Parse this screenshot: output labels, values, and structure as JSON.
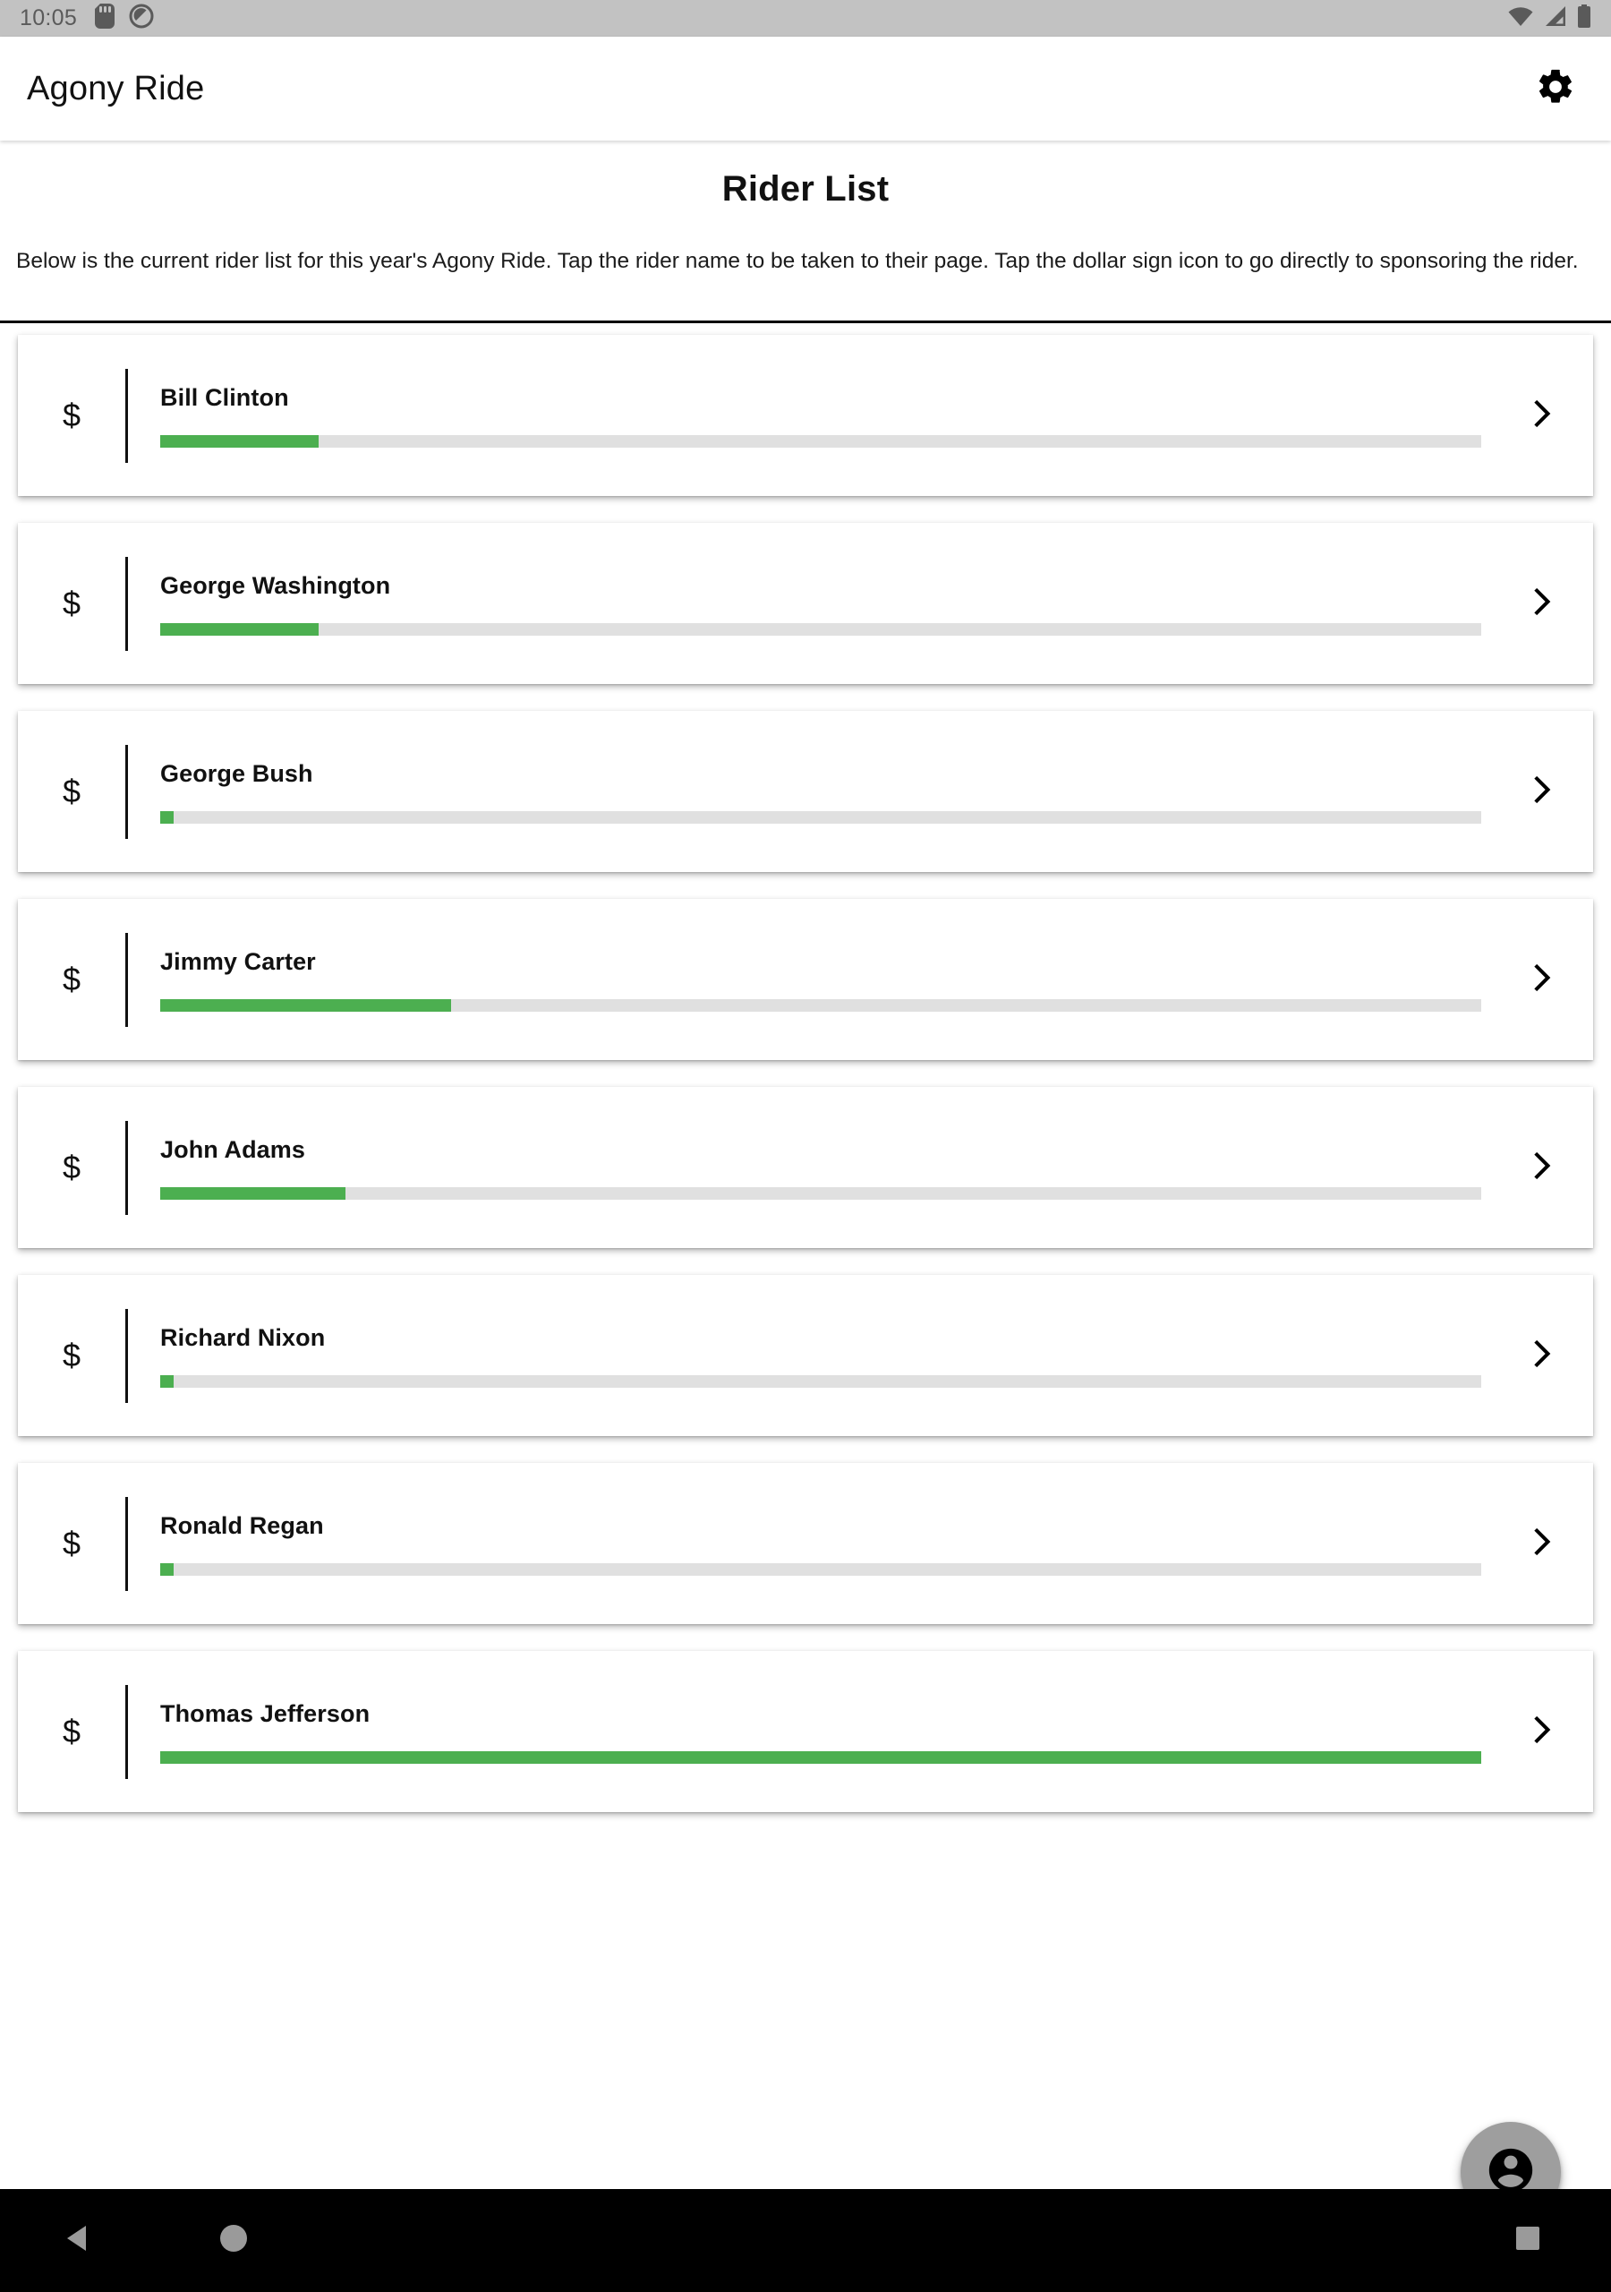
{
  "status_bar": {
    "time": "10:05",
    "left_icons": [
      "sd-card-icon",
      "android-auto-icon"
    ],
    "right_icons": [
      "wifi-icon",
      "cell-signal-icon",
      "battery-icon"
    ],
    "background_color": "#c2c2c2"
  },
  "app_bar": {
    "title": "Agony Ride",
    "settings_icon": "gear-icon"
  },
  "main": {
    "page_title": "Rider List",
    "description": "Below is the current rider list for this year's Agony Ride. Tap the rider name to be taken to their page. Tap the dollar sign icon to go directly to sponsoring the rider.",
    "sponsor_icon_label": "$",
    "chevron_icon": "chevron-right-icon",
    "progress_fill_color": "#4CAF50",
    "progress_track_color": "#e0e0e0",
    "riders": [
      {
        "name": "Bill Clinton",
        "progress_percent": 12,
        "sponsor_label": "$"
      },
      {
        "name": "George Washington",
        "progress_percent": 12,
        "sponsor_label": "$"
      },
      {
        "name": "George Bush",
        "progress_percent": 1,
        "sponsor_label": "$"
      },
      {
        "name": "Jimmy Carter",
        "progress_percent": 22,
        "sponsor_label": "$"
      },
      {
        "name": "John Adams",
        "progress_percent": 14,
        "sponsor_label": "$"
      },
      {
        "name": "Richard Nixon",
        "progress_percent": 1,
        "sponsor_label": "$"
      },
      {
        "name": "Ronald Regan",
        "progress_percent": 1,
        "sponsor_label": "$"
      },
      {
        "name": "Thomas Jefferson",
        "progress_percent": 100,
        "sponsor_label": "$"
      }
    ]
  },
  "fab": {
    "icon": "account-circle-icon",
    "background_color": "#9e9e9e"
  },
  "nav_bar": {
    "background_color": "#000000",
    "buttons": [
      "back-icon",
      "home-icon",
      "recents-icon"
    ]
  }
}
